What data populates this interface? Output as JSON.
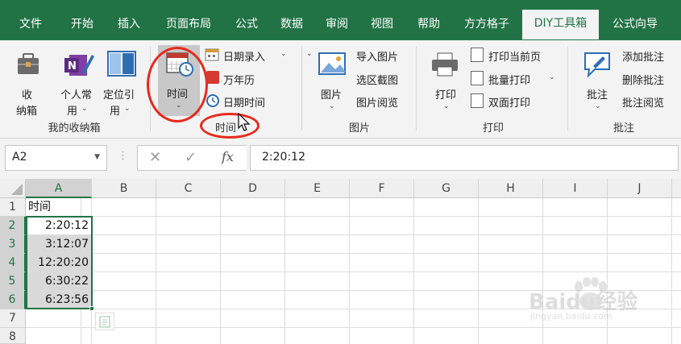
{
  "tabs": [
    "文件",
    "开始",
    "插入",
    "页面布局",
    "公式",
    "数据",
    "审阅",
    "视图",
    "帮助",
    "方方格子",
    "DIY工具箱",
    "公式向导"
  ],
  "active_tab": "DIY工具箱",
  "ribbon": {
    "collection": {
      "buttons": [
        {
          "label1": "收",
          "label2": "纳箱"
        },
        {
          "label1": "个人常",
          "label2": "用"
        },
        {
          "label1": "定位引",
          "label2": "用"
        }
      ],
      "group_label": "我的收纳箱"
    },
    "time": {
      "big_button": "时间",
      "small_buttons": [
        "日期录入",
        "万年历",
        "日期时间"
      ],
      "group_label": "时间"
    },
    "picture": {
      "big_button": "图片",
      "small_buttons": [
        "导入图片",
        "选区截图",
        "图片阅览"
      ],
      "group_label": "图片"
    },
    "print": {
      "big_button": "打印",
      "small_buttons": [
        "打印当前页",
        "批量打印",
        "双面打印"
      ],
      "group_label": "打印"
    },
    "comment": {
      "big_button": "批注",
      "small_buttons": [
        "添加批注",
        "删除批注",
        "批注阅览"
      ],
      "group_label": "批注"
    }
  },
  "formula_bar": {
    "name_box": "A2",
    "fx": "fx",
    "value": "2:20:12"
  },
  "columns": [
    "A",
    "B",
    "C",
    "D",
    "E",
    "F",
    "G",
    "H",
    "I",
    "J"
  ],
  "rows": [
    "1",
    "2",
    "3",
    "4",
    "5",
    "6",
    "7",
    "8"
  ],
  "cells": {
    "header": "时间",
    "times": [
      "2:20:12",
      "3:12:07",
      "12:20:20",
      "6:30:22",
      "6:23:56"
    ]
  },
  "watermark": {
    "text": "Baidu经验",
    "url": "jingyan.baidu.com"
  },
  "colors": {
    "brand": "#217346",
    "highlight": "#e8291c"
  }
}
